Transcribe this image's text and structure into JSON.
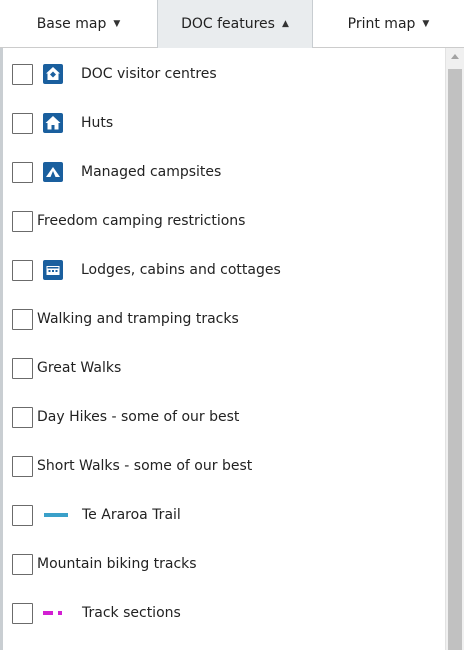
{
  "tabs": {
    "base_map": "Base map",
    "doc_features": "DOC features",
    "print_map": "Print map"
  },
  "colors": {
    "icon_blue": "#1a5f9e",
    "te_araroa_line": "#3aa0c9",
    "track_sections_line": "#d21fd2"
  },
  "layers": [
    {
      "label": "DOC visitor centres",
      "icon": "visitor-centre-icon"
    },
    {
      "label": "Huts",
      "icon": "hut-icon"
    },
    {
      "label": "Managed campsites",
      "icon": "campsite-icon"
    },
    {
      "label": "Freedom camping restrictions",
      "icon": ""
    },
    {
      "label": "Lodges, cabins and cottages",
      "icon": "lodge-icon"
    },
    {
      "label": "Walking and tramping tracks",
      "icon": ""
    },
    {
      "label": "Great Walks",
      "icon": ""
    },
    {
      "label": "Day Hikes - some of our best",
      "icon": ""
    },
    {
      "label": "Short Walks - some of our best",
      "icon": ""
    },
    {
      "label": "Te Araroa Trail",
      "icon": "te-araroa-line-icon"
    },
    {
      "label": "Mountain biking tracks",
      "icon": ""
    },
    {
      "label": "Track sections",
      "icon": "track-sections-dashed-icon"
    }
  ]
}
